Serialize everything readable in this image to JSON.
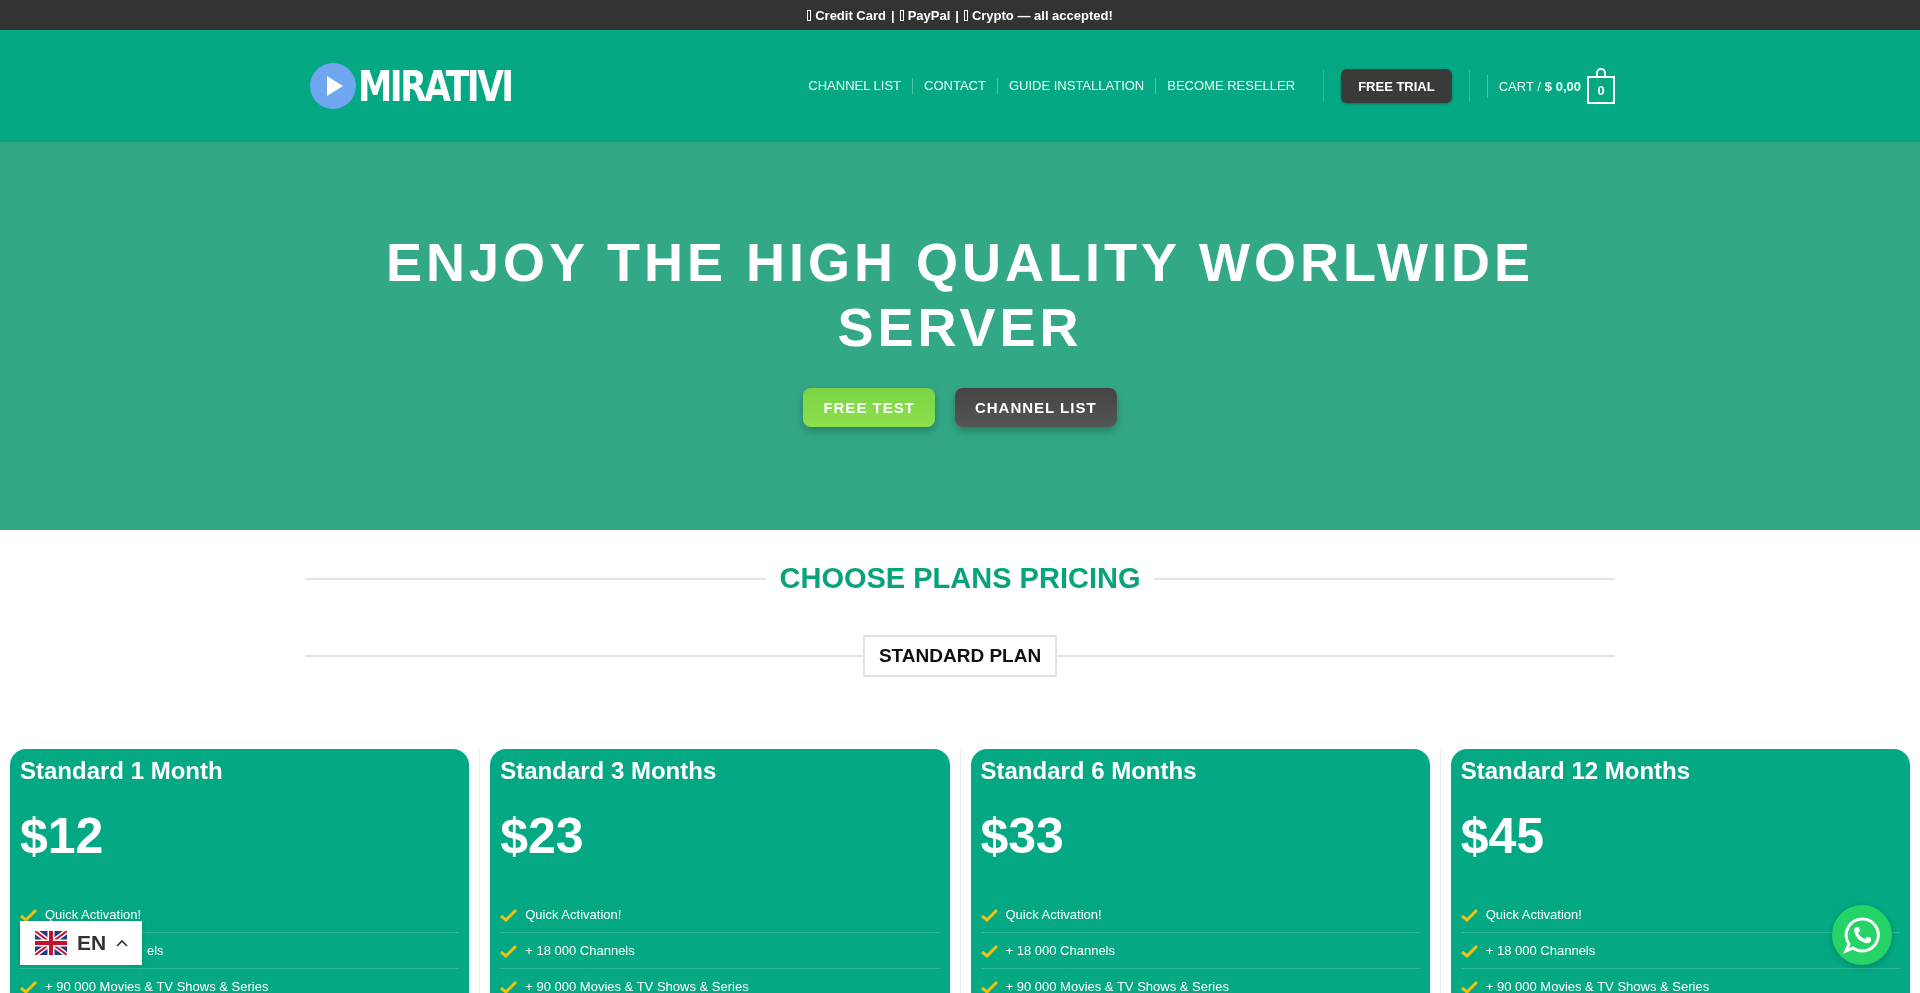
{
  "top_bar": {
    "segments": [
      {
        "text": "Credit Card"
      },
      {
        "text": "PayPal"
      },
      {
        "text": "Crypto — all accepted!"
      }
    ],
    "separator": "|"
  },
  "header": {
    "logo": "MIRATIVI",
    "nav": [
      "CHANNEL LIST",
      "CONTACT",
      "GUIDE INSTALLATION",
      "BECOME RESELLER"
    ],
    "cta": "FREE TRIAL",
    "cart": {
      "label": "CART /",
      "amount": "$ 0,00",
      "count": "0"
    }
  },
  "hero": {
    "title_lines": [
      "ENJOY THE HIGH QUALITY WORLWIDE",
      "SERVER"
    ],
    "buttons": [
      {
        "label": "FREE TEST",
        "kind": "primary"
      },
      {
        "label": "CHANNEL LIST",
        "kind": "secondary"
      }
    ]
  },
  "pricing": {
    "title": "CHOOSE PLANS PRICING",
    "subtitle": "STANDARD PLAN"
  },
  "plans": [
    {
      "name": "Standard 1 Month",
      "price": "$12",
      "features": [
        {
          "text": "Quick Activation!",
          "covered": false
        },
        {
          "text": "els",
          "covered": true
        },
        {
          "text": "+ 90 000 Movies & TV Shows & Series",
          "covered": false
        }
      ]
    },
    {
      "name": "Standard 3 Months",
      "price": "$23",
      "features": [
        {
          "text": "Quick Activation!",
          "covered": false
        },
        {
          "text": "+ 18 000 Channels",
          "covered": false
        },
        {
          "text": "+ 90 000 Movies & TV Shows & Series",
          "covered": false
        }
      ]
    },
    {
      "name": "Standard 6 Months",
      "price": "$33",
      "features": [
        {
          "text": "Quick Activation!",
          "covered": false
        },
        {
          "text": "+ 18 000 Channels",
          "covered": false
        },
        {
          "text": "+ 90 000 Movies & TV Shows & Series",
          "covered": false
        }
      ]
    },
    {
      "name": "Standard 12 Months",
      "price": "$45",
      "features": [
        {
          "text": "Quick Activation!",
          "covered": false
        },
        {
          "text": "+ 18 000 Channels",
          "covered": false
        },
        {
          "text": "+ 90 000 Movies & TV Shows & Series",
          "covered": false
        }
      ]
    }
  ],
  "language": {
    "code": "EN"
  }
}
